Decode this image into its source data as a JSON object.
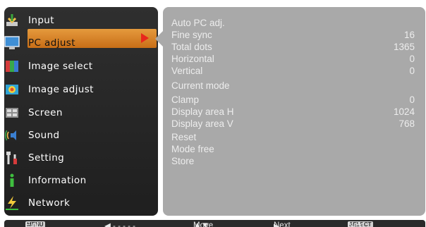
{
  "menu": {
    "items": [
      {
        "label": "Input",
        "icon": "input-icon"
      },
      {
        "label": "PC adjust",
        "icon": "pc-adjust-icon"
      },
      {
        "label": "Image select",
        "icon": "image-select-icon"
      },
      {
        "label": "Image adjust",
        "icon": "image-adjust-icon"
      },
      {
        "label": "Screen",
        "icon": "screen-icon"
      },
      {
        "label": "Sound",
        "icon": "sound-icon"
      },
      {
        "label": "Setting",
        "icon": "setting-icon"
      },
      {
        "label": "Information",
        "icon": "information-icon"
      },
      {
        "label": "Network",
        "icon": "network-icon"
      }
    ],
    "selected": "PC adjust",
    "accent_color": "#d9832a",
    "arrow_color": "#e8261c"
  },
  "panel": {
    "rows": [
      {
        "label": "Auto PC adj.",
        "value": ""
      },
      {
        "label": "Fine sync",
        "value": "16"
      },
      {
        "label": "Total dots",
        "value": "1365"
      },
      {
        "label": "Horizontal",
        "value": "0"
      },
      {
        "label": "Vertical",
        "value": "0"
      },
      {
        "label": "Current mode",
        "value": ""
      },
      {
        "label": "Clamp",
        "value": "0"
      },
      {
        "label": "Display area H",
        "value": "1024"
      },
      {
        "label": "Display area V",
        "value": "768"
      },
      {
        "label": "Reset",
        "value": ""
      },
      {
        "label": "Mode free",
        "value": ""
      },
      {
        "label": "Store",
        "value": ""
      }
    ]
  },
  "status_bar": {
    "exit_key": "MENU",
    "exit_label": "Exit",
    "back_label": "◀ - - - - -",
    "move_label": "Move",
    "next_label": "Next",
    "select_key": "SELECT",
    "select_next_label": "Next"
  }
}
